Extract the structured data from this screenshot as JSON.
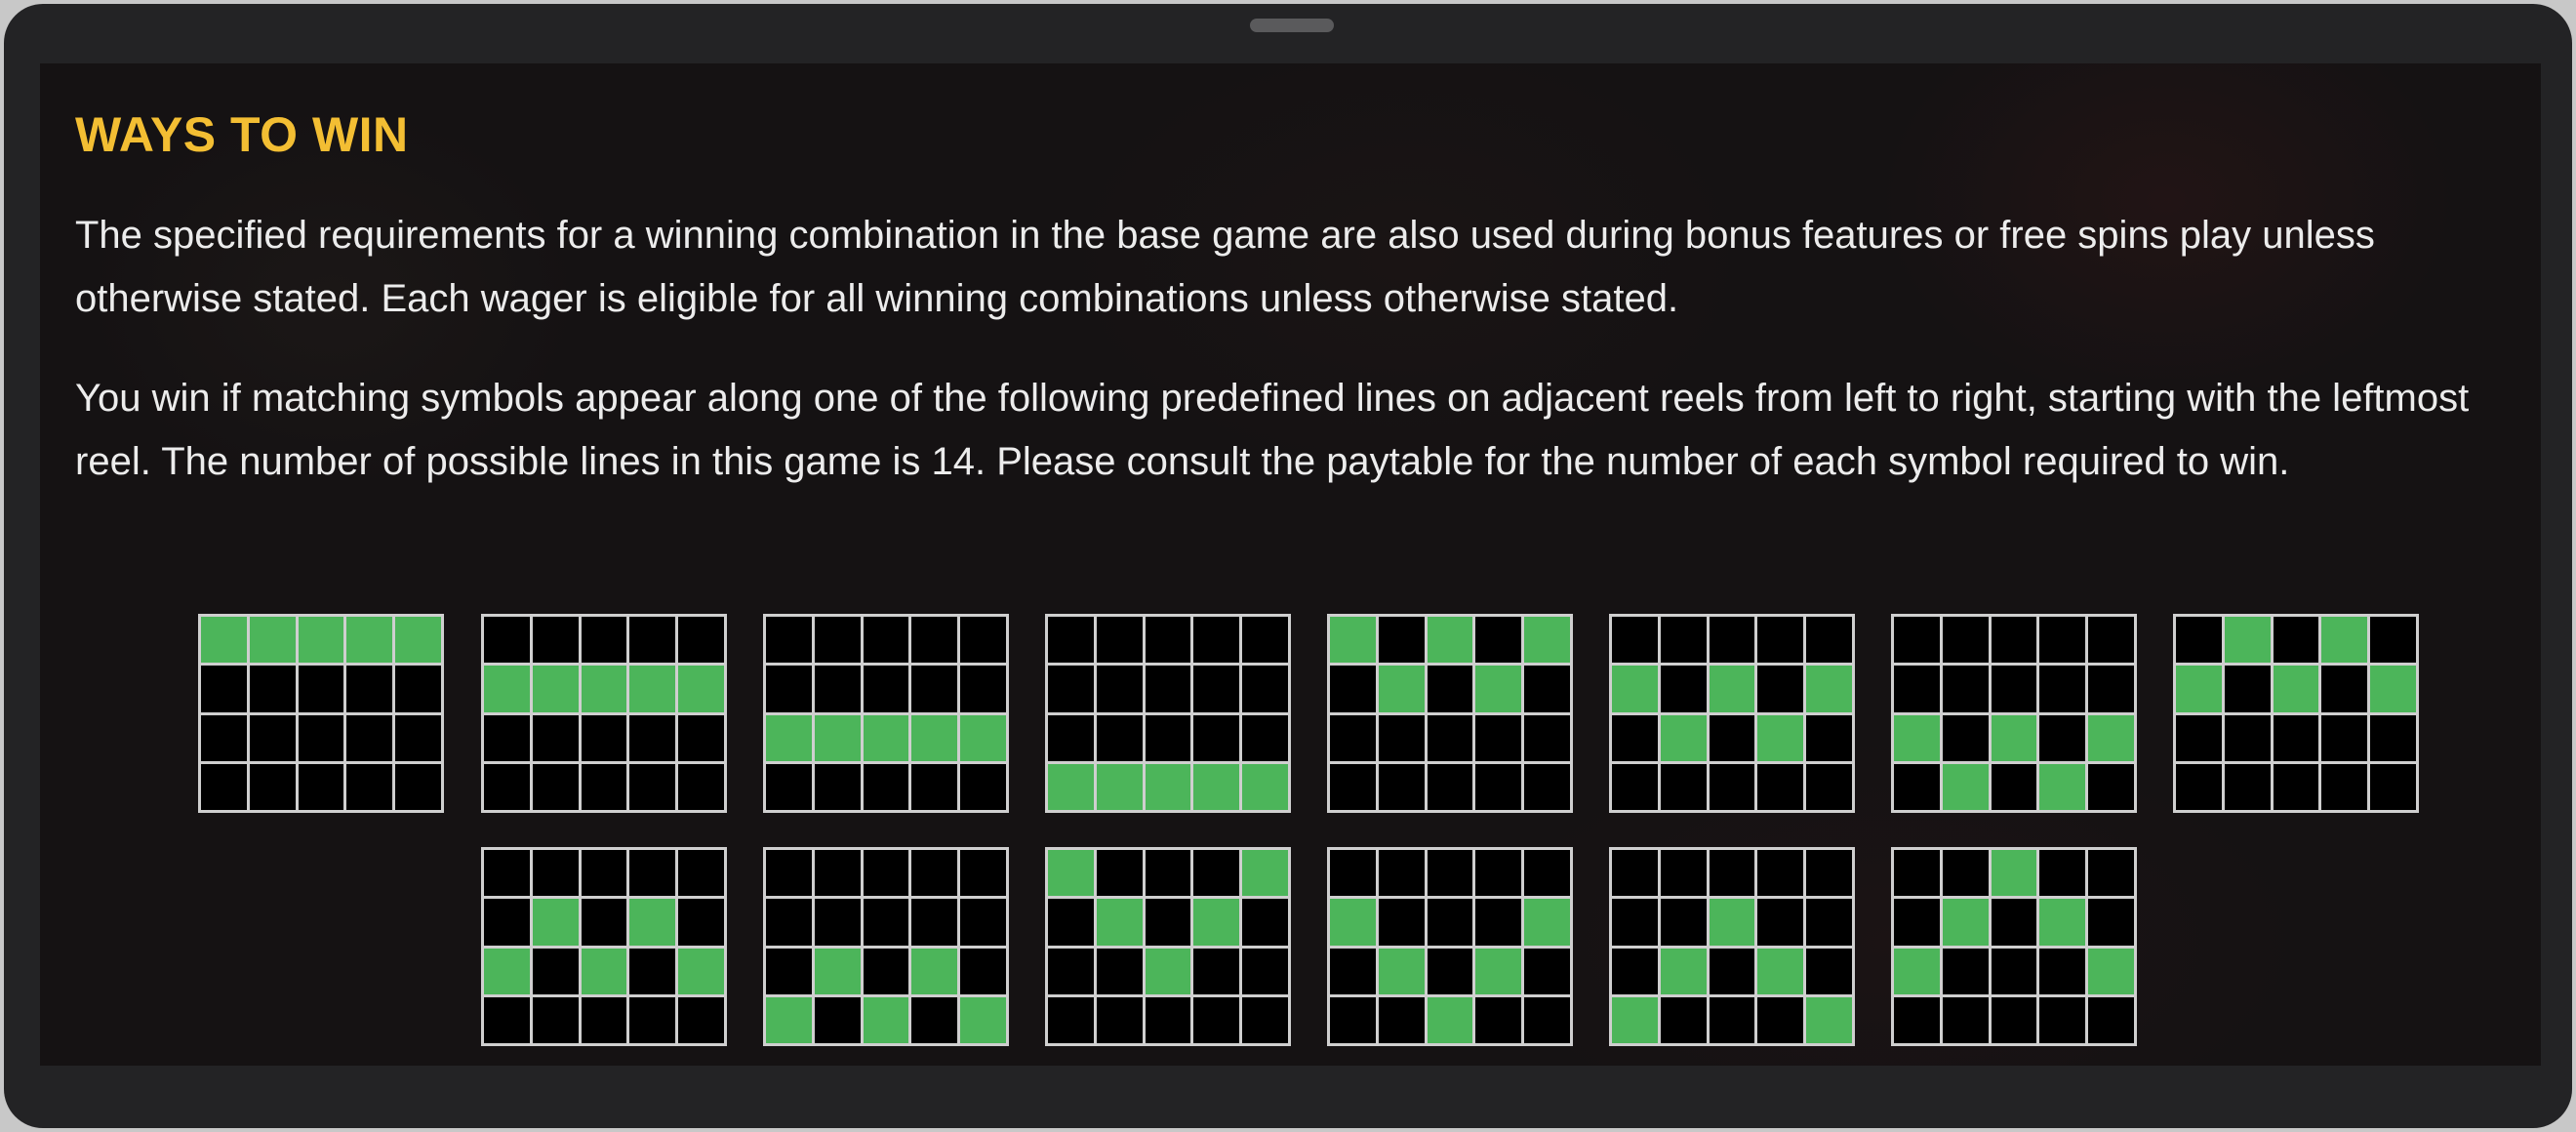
{
  "panel": {
    "title": "WAYS TO WIN",
    "paragraph_1": "The specified requirements for a winning combination in the base game are also used during bonus features or free spins play unless otherwise stated. Each wager is eligible for all winning combinations unless otherwise stated.",
    "paragraph_2": "You win if matching symbols appear along one of the following predefined lines on adjacent reels from left to right, starting with the leftmost reel. The number of possible lines in this game is 14. Please consult the paytable for the number of each symbol required to win."
  },
  "colors": {
    "title": "#f3be33",
    "highlight_cell": "#4cb55a",
    "empty_cell": "#000000",
    "grid_border": "#cfcfcf"
  },
  "paylines": [
    {
      "rows": [
        0,
        0,
        0,
        0,
        0
      ]
    },
    {
      "rows": [
        1,
        1,
        1,
        1,
        1
      ]
    },
    {
      "rows": [
        2,
        2,
        2,
        2,
        2
      ]
    },
    {
      "rows": [
        3,
        3,
        3,
        3,
        3
      ]
    },
    {
      "rows": [
        0,
        1,
        0,
        1,
        0
      ]
    },
    {
      "rows": [
        1,
        2,
        1,
        2,
        1
      ]
    },
    {
      "rows": [
        2,
        3,
        2,
        3,
        2
      ]
    },
    {
      "rows": [
        1,
        0,
        1,
        0,
        1
      ]
    },
    {
      "rows": [
        2,
        1,
        2,
        1,
        2
      ]
    },
    {
      "rows": [
        3,
        2,
        3,
        2,
        3
      ]
    },
    {
      "rows": [
        0,
        1,
        2,
        1,
        0
      ]
    },
    {
      "rows": [
        1,
        2,
        3,
        2,
        1
      ]
    },
    {
      "rows": [
        3,
        2,
        1,
        2,
        3
      ]
    },
    {
      "rows": [
        2,
        1,
        0,
        1,
        2
      ]
    }
  ]
}
